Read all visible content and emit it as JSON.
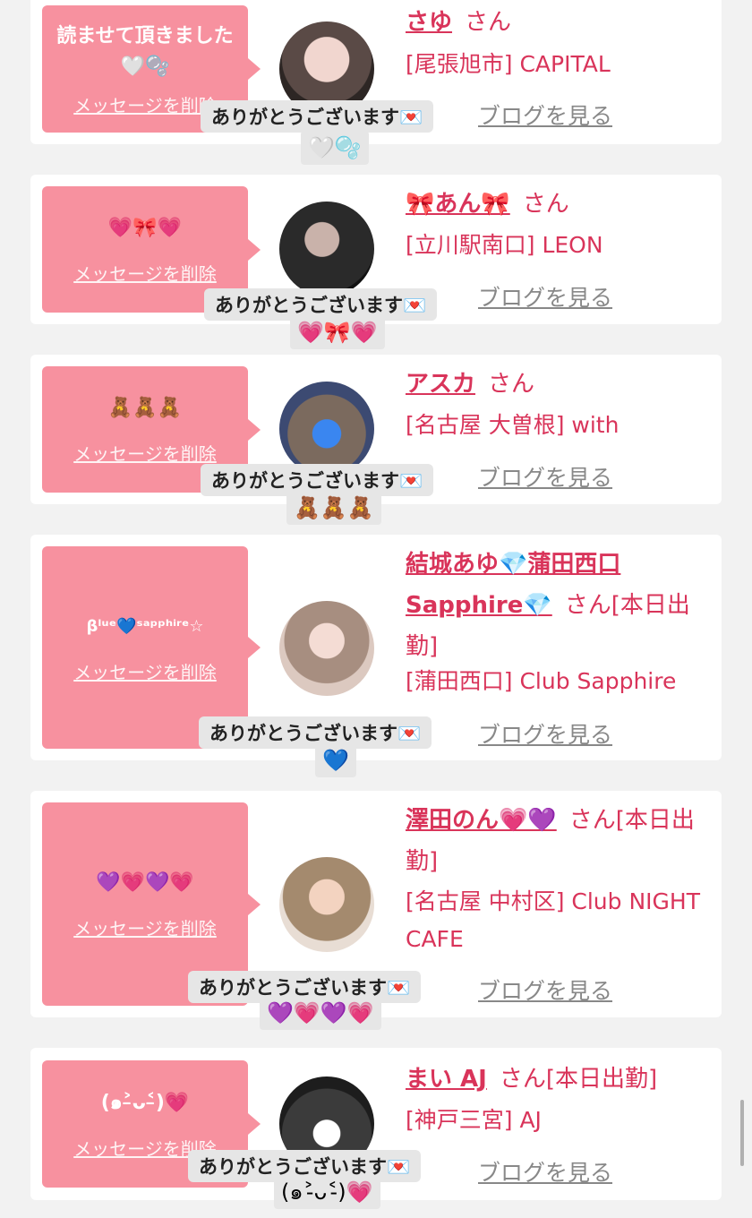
{
  "delete_label": "メッセージを削除",
  "blog_label": "ブログを見る",
  "san_label": "さん",
  "thanks_label": "ありがとうございます💌",
  "cards": [
    {
      "message": "読ませて頂きました🤍🫧",
      "name": "さゆ",
      "status": "",
      "shop": "[尾張旭市] CAPITAL",
      "reply": "🤍🫧"
    },
    {
      "message": "💗🎀💗",
      "name": "🎀あん🎀",
      "status": "",
      "shop": "[立川駅南口] LEON",
      "reply": "💗🎀💗"
    },
    {
      "message": "🧸🧸🧸",
      "name": "アスカ",
      "status": "",
      "shop": "[名古屋 大曽根] with",
      "reply": "🧸🧸🧸"
    },
    {
      "message": "βˡᵘᵉ💙ˢᵃᵖᵖʰⁱʳᵉ☆",
      "name": "結城あゆ💎蒲田西口Sapphire💎",
      "status": "[本日出勤]",
      "shop": "[蒲田西口] Club Sapphire",
      "reply": "💙"
    },
    {
      "message": "💜💗💜💗",
      "name": "澤田のん💗💜",
      "status": "[本日出勤]",
      "shop": "[名古屋 中村区] Club NIGHT CAFE",
      "reply": "💜💗💜💗"
    },
    {
      "message": "(๑˃̵ᴗ˂̵)💗",
      "name": "まい AJ",
      "status": "[本日出勤]",
      "shop": "[神戸三宮] AJ",
      "reply": "(๑˃̵ᴗ˂̵)💗"
    }
  ],
  "colors": {
    "accent": "#d9345a",
    "bubble": "#f7919f",
    "card": "#ffffff",
    "background": "#f2f2f2"
  }
}
